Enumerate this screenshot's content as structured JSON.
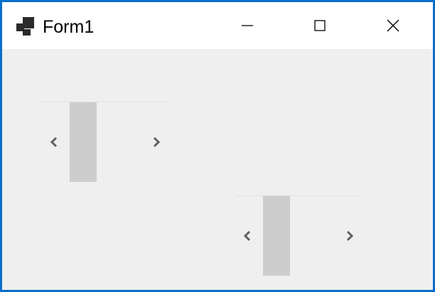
{
  "window": {
    "title": "Form1",
    "icons": {
      "app": "windows-forms-app-icon",
      "minimize": "minimize-icon",
      "maximize": "maximize-icon",
      "close": "close-icon"
    }
  },
  "scrollbars": [
    {
      "orientation": "horizontal",
      "left_arrow_icon": "chevron-left-icon",
      "right_arrow_icon": "chevron-right-icon"
    },
    {
      "orientation": "horizontal",
      "left_arrow_icon": "chevron-left-icon",
      "right_arrow_icon": "chevron-right-icon"
    }
  ],
  "colors": {
    "window_border": "#0a6fc9",
    "titlebar_bg": "#ffffff",
    "client_bg": "#efefef",
    "scroll_thumb": "#cdcdcd",
    "scroll_arrow": "#606060"
  }
}
